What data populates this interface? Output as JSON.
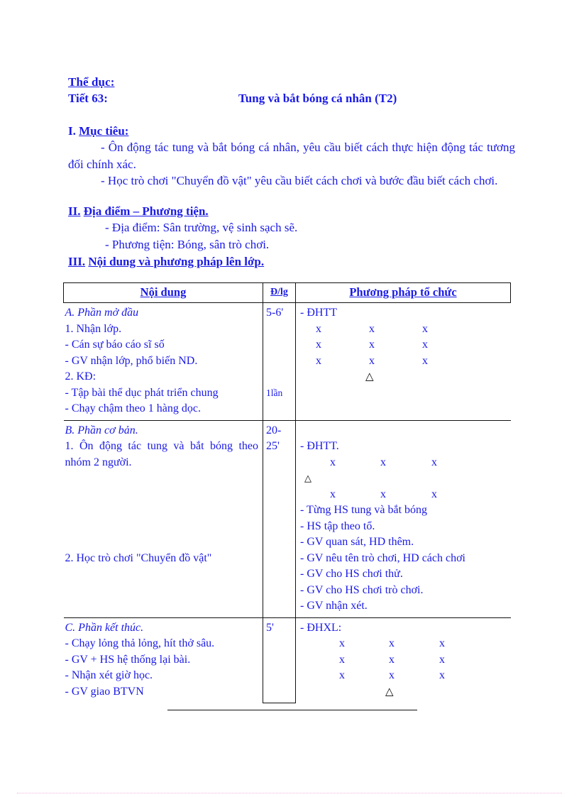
{
  "header": {
    "subject": "Thể dục:",
    "lesson_number": "Tiết 63:",
    "lesson_title": "Tung và bắt bóng cá nhân (T2)"
  },
  "sections": [
    {
      "number": "I.",
      "heading": "Mục tiêu:",
      "lines": [
        "- Ôn động tác tung và bắt bóng cá nhân, yêu cầu biết cách thực hiện động tác tương đối chính xác.",
        "- Học trò chơi \"Chuyển đồ vật\" yêu cầu biết cách chơi và bước đầu biết cách chơi."
      ]
    },
    {
      "number": "II.",
      "heading": "Địa điểm – Phương tiện.",
      "lines": [
        "- Địa điểm: Sân trường, vệ sinh sạch sẽ.",
        "- Phương tiện: Bóng, sân trò chơi."
      ]
    },
    {
      "number": "III.",
      "heading": "Nội dung và phương pháp lên lớp.",
      "lines": []
    }
  ],
  "table": {
    "columns": {
      "content": "Nội dung",
      "duration": "Đ/lg",
      "method": "Phương pháp tổ chức"
    },
    "rows": [
      {
        "content_lines": [
          "A. Phần mở đầu",
          "1. Nhận  lớp.",
          "- Cán sự báo cáo sĩ số",
          "- GV nhận lớp, phổ biến ND.",
          "2. KĐ:",
          "- Tập bài thể dục phát triển chung",
          "- Chạy chậm theo 1 hàng dọc."
        ],
        "duration_values": [
          "5-6'",
          "1lần"
        ],
        "method_lines": [
          "- ĐHTT"
        ]
      },
      {
        "content_lines": [
          "B. Phần cơ bản.",
          "1. Ôn động tác tung và bắt bóng theo nhóm 2 người.",
          "2. Học trò chơi \"Chuyển đồ vật\""
        ],
        "duration_values": [
          "20-",
          "25'"
        ],
        "method_lines": [
          "- ĐHTT.",
          "- Từng HS tung và bắt bóng",
          "- HS tập theo tổ.",
          "- GV quan sát, HD thêm.",
          "- GV nêu tên trò chơi, HD cách chơi",
          "- GV cho HS chơi thử.",
          "- GV cho HS chơi trò chơi.",
          "- GV nhận xét."
        ]
      },
      {
        "content_lines": [
          "C. Phần kết thúc.",
          "- Chạy lỏng thả lỏng, hít thở sâu.",
          "- GV + HS hệ thống lại bài.",
          "- Nhận xét giờ học.",
          "- GV giao BTVN"
        ],
        "duration_values": [
          "5'"
        ],
        "method_lines": [
          "- ĐHXL:"
        ]
      }
    ],
    "formation_marker": "x",
    "teacher_marker": "△"
  }
}
